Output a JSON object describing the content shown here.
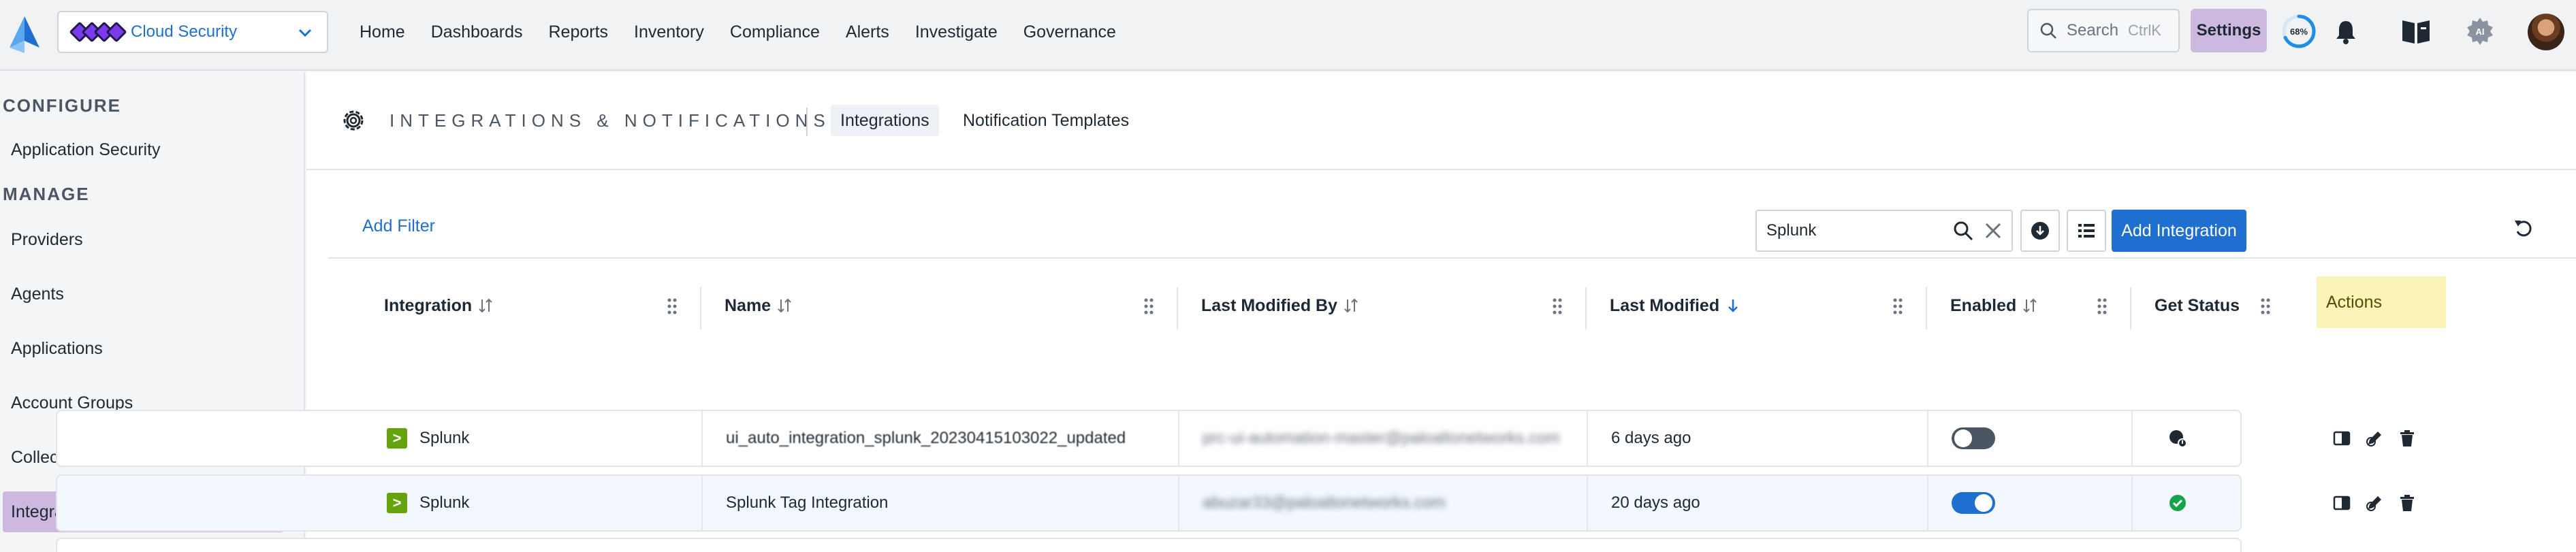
{
  "header": {
    "tenant": "Cloud Security",
    "nav": [
      "Home",
      "Dashboards",
      "Reports",
      "Inventory",
      "Compliance",
      "Alerts",
      "Investigate",
      "Governance"
    ],
    "search_placeholder": "Search",
    "search_shortcut": "CtrlK",
    "settings_label": "Settings",
    "progress_label": "68%",
    "progress_value": 0.68,
    "ai_label": "AI",
    "accent_color": "#1f6fd1",
    "settings_color": "#cdb8e0"
  },
  "sidebar": {
    "configure_label": "CONFIGURE",
    "configure_items": [
      "Application Security"
    ],
    "manage_label": "MANAGE",
    "manage_items": [
      "Providers",
      "Agents",
      "Applications",
      "Account Groups",
      "Collections",
      "Integrations & Notifications"
    ],
    "active_item": "Integrations & Notifications"
  },
  "page": {
    "title": "INTEGRATIONS & NOTIFICATIONS",
    "tabs": [
      "Integrations",
      "Notification Templates"
    ],
    "active_tab": "Integrations",
    "add_filter": "Add Filter"
  },
  "toolbar": {
    "search_value": "Splunk",
    "add_integration": "Add Integration"
  },
  "table": {
    "columns": [
      "Integration",
      "Name",
      "Last Modified By",
      "Last Modified",
      "Enabled",
      "Get Status",
      "Actions"
    ],
    "rows": [
      {
        "integration": "Splunk",
        "name": "ui_auto_integration_splunk_20230415103022_updated",
        "modified_by": "prc-ui-automation-master@paloaltonetworks.com",
        "modified": "6 days ago",
        "enabled": false,
        "status": "error"
      },
      {
        "integration": "Splunk",
        "name": "Splunk Tag Integration",
        "modified_by": "abuzar33@paloaltonetworks.com",
        "modified": "20 days ago",
        "enabled": true,
        "status": "ok"
      }
    ]
  }
}
